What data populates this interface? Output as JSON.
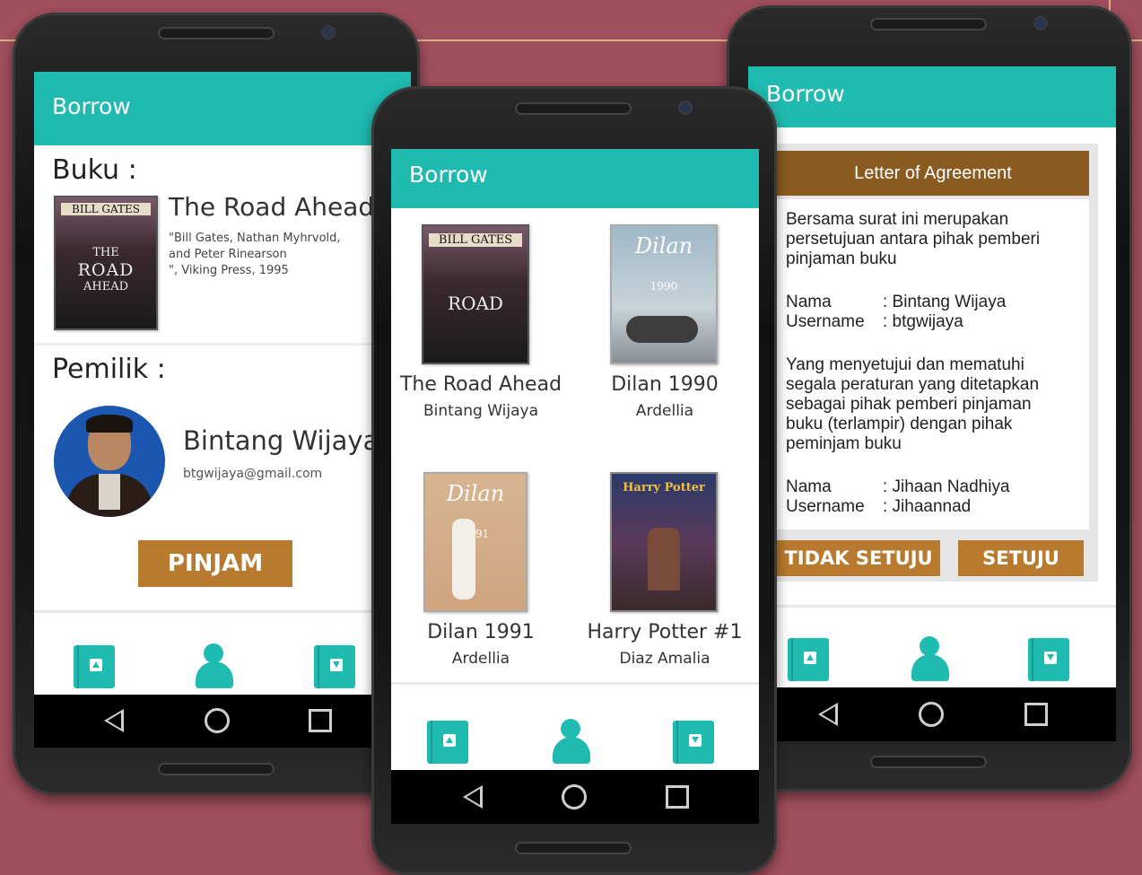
{
  "colors": {
    "background": "#a14f5d",
    "appbar": "#1fbab0",
    "button": "#b87a2e",
    "agreement_header": "#8a5b20"
  },
  "left_screen": {
    "appbar_title": "Borrow",
    "book_heading": "Buku :",
    "book_cover": {
      "author": "BILL GATES",
      "line1": "THE",
      "line2": "ROAD",
      "line3": "AHEAD"
    },
    "book_title": "The Road Ahead",
    "book_meta_1": "\"Bill Gates, Nathan Myhrvold,",
    "book_meta_2": "and Peter Rinearson",
    "book_meta_3": "\", Viking Press, 1995",
    "owner_heading": "Pemilik :",
    "owner_name": "Bintang Wijaya",
    "owner_email": "btgwijaya@gmail.com",
    "borrow_button": "PINJAM"
  },
  "middle_screen": {
    "appbar_title": "Borrow",
    "books": [
      {
        "title": "The Road Ahead",
        "owner": "Bintang Wijaya",
        "cover_text": "BILL GATES"
      },
      {
        "title": "Dilan 1990",
        "owner": "Ardellia",
        "cover_text": "Dilan",
        "cover_year": "1990"
      },
      {
        "title": "Dilan 1991",
        "owner": "Ardellia",
        "cover_text": "Dilan",
        "cover_year": "1991"
      },
      {
        "title": "Harry Potter #1",
        "owner": "Diaz Amalia",
        "cover_text": "Harry Potter"
      }
    ]
  },
  "right_screen": {
    "appbar_title": "Borrow",
    "agreement_title": "Letter of Agreement",
    "para1_l1": "Bersama surat ini merupakan",
    "para1_l2": "persetujuan antara pihak pemberi",
    "para1_l3": "pinjaman buku",
    "lender_name_label": "Nama",
    "lender_name_value": ": Bintang Wijaya",
    "lender_user_label": "Username",
    "lender_user_value": ": btgwijaya",
    "para2_l1": "Yang menyetujui dan mematuhi",
    "para2_l2": "segala peraturan yang ditetapkan",
    "para2_l3": "sebagai pihak pemberi pinjaman",
    "para2_l4": "buku (terlampir) dengan pihak",
    "para2_l5": "peminjam buku",
    "borrower_name_label": "Nama",
    "borrower_name_value": ": Jihaan Nadhiya",
    "borrower_user_label": "Username",
    "borrower_user_value": ": Jihaannad",
    "disagree_button": "TIDAK SETUJU",
    "agree_button": "SETUJU"
  },
  "icons": [
    "book-upload-icon",
    "profile-icon",
    "book-download-icon",
    "nav-back-icon",
    "nav-home-icon",
    "nav-recent-icon"
  ]
}
